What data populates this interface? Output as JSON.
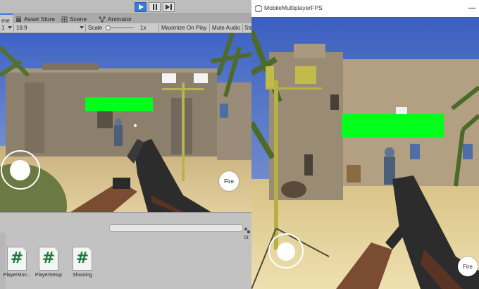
{
  "editor": {
    "tabs": [
      {
        "label": "me"
      },
      {
        "label": "Asset Store"
      },
      {
        "label": "Scene"
      },
      {
        "label": "Animator"
      }
    ],
    "toolbar": {
      "display_value": "1",
      "aspect_value": "16:9",
      "scale_label": "Scale",
      "scale_value": "1x",
      "maximize_on_play": "Maximize On Play",
      "mute_audio": "Mute Audio",
      "stats": "Sta"
    },
    "game_ui": {
      "fire_label": "Fire"
    },
    "project": {
      "assets": [
        {
          "name": "PlayerMov...",
          "icon": "csharp-script-icon"
        },
        {
          "name": "PlayerSetup",
          "icon": "csharp-script-icon"
        },
        {
          "name": "Shooting",
          "icon": "csharp-script-icon"
        }
      ],
      "side_label": "St"
    }
  },
  "player": {
    "window_title": "MobileMultiplayerFPS",
    "fire_label": "Fire"
  },
  "colors": {
    "play_active": "#3a79d8",
    "health_bar": "#00ff1a",
    "script_hash": "#1d7a3a"
  }
}
